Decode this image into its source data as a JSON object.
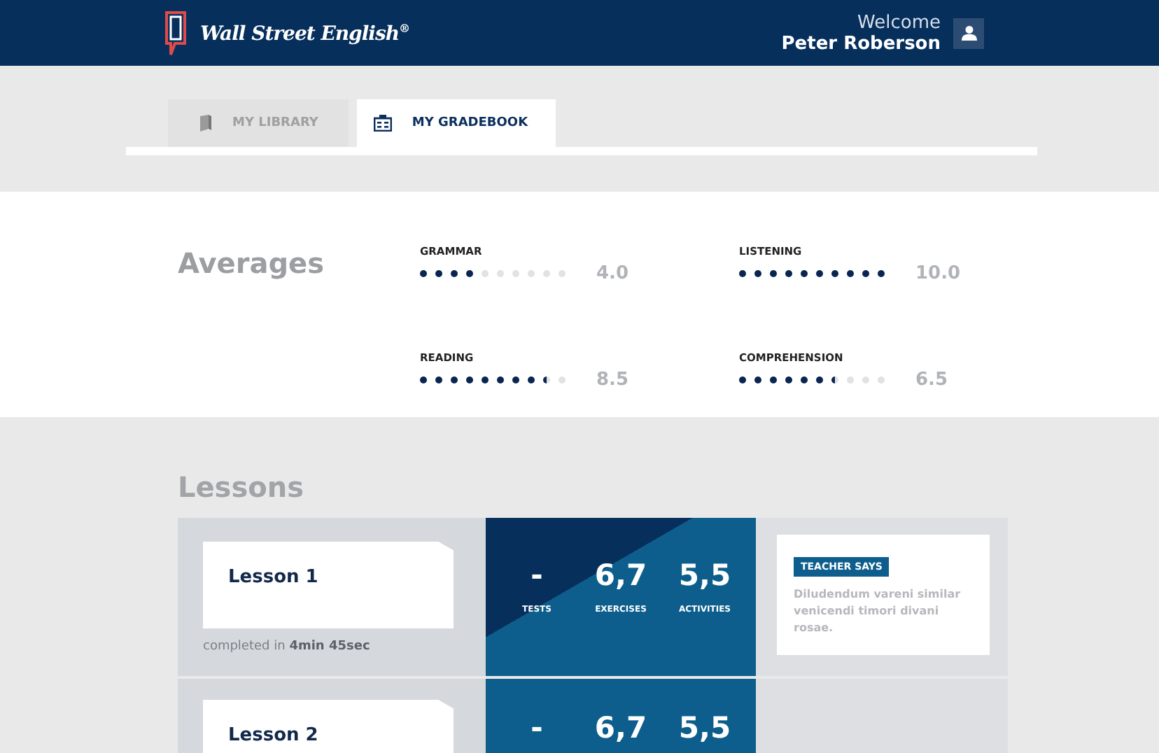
{
  "header": {
    "brand": "Wall Street English$^{®}$",
    "welcome": "Welcome",
    "user_name": "Peter Roberson"
  },
  "tabs": [
    {
      "label": "MY LIBRARY",
      "selected": false
    },
    {
      "label": "MY GRADEBOOK",
      "selected": true
    }
  ],
  "averages": {
    "title": "Averages",
    "skills": [
      {
        "name": "GRAMMAR",
        "stars": 4,
        "score": "4.0"
      },
      {
        "name": "LISTENING",
        "stars": 10,
        "score": "10.0"
      },
      {
        "name": "READING",
        "stars": 8.5,
        "score": "8.5"
      },
      {
        "name": "COMPREHENSION",
        "stars": 6.5,
        "score": "6.5"
      }
    ]
  },
  "lessons": {
    "title": "Lessons",
    "items": [
      {
        "title": "Lesson 1",
        "completed": "completed in **4min 45sec**",
        "scores": [
          {
            "value": "-",
            "label": "TESTS"
          },
          {
            "value": "6,7",
            "label": "EXERCISES"
          },
          {
            "value": "5,5",
            "label": "ACTIVITIES"
          }
        ],
        "teacher": {
          "tag": "TEACHER SAYS",
          "comment": "Diludendum vareni similar venicendi timori divani rosae."
        }
      },
      {
        "title": "Lesson 2",
        "scores": [
          {
            "value": "-"
          },
          {
            "value": "6,7"
          },
          {
            "value": "5,5"
          }
        ]
      }
    ]
  }
}
